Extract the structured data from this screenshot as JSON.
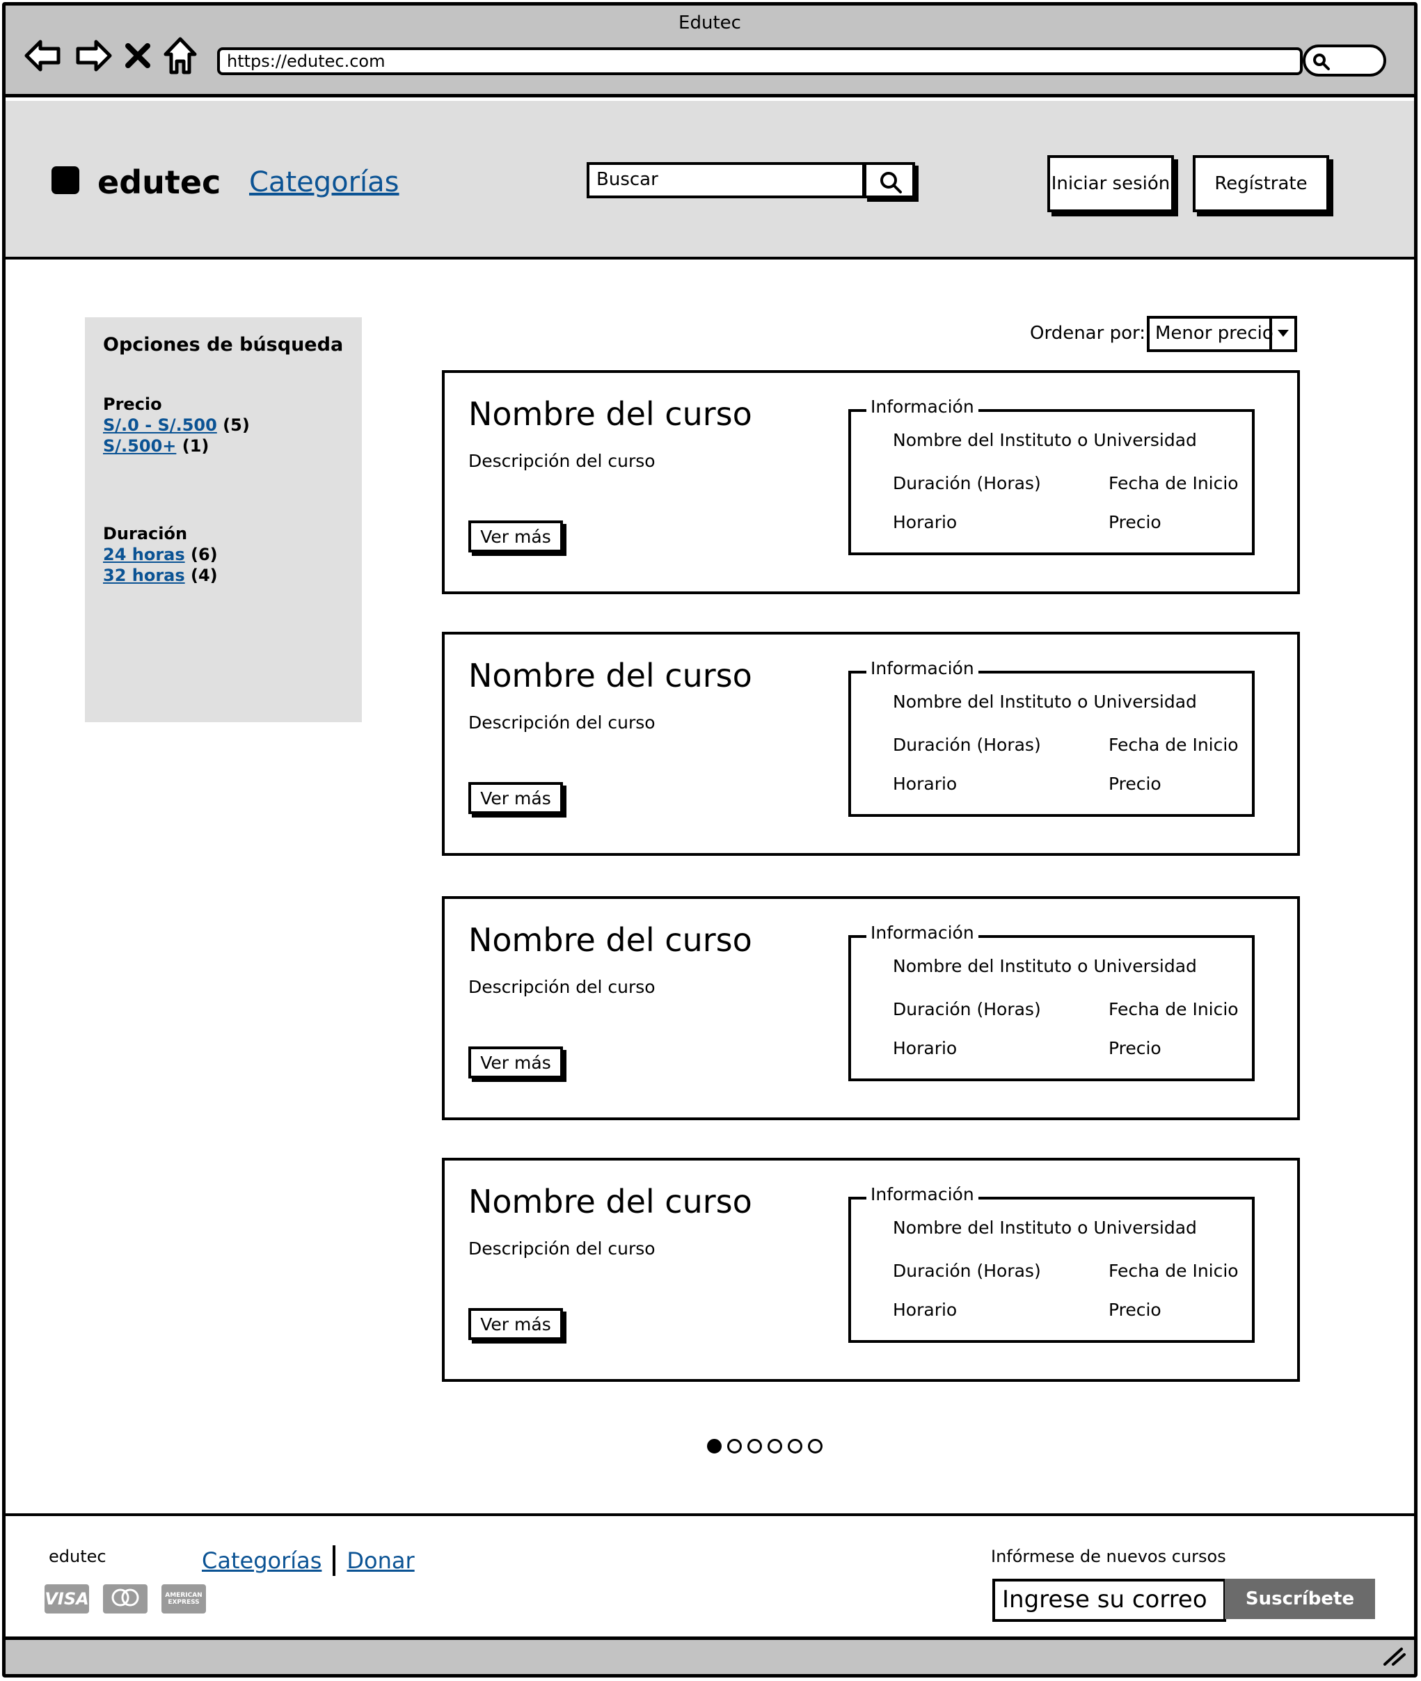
{
  "window": {
    "title": "Edutec"
  },
  "browser": {
    "url": "https://edutec.com",
    "icons": [
      "back-arrow-icon",
      "forward-arrow-icon",
      "close-x-icon",
      "home-icon",
      "search-icon"
    ]
  },
  "header": {
    "brand": "edutec",
    "categories_link": "Categorías",
    "search_placeholder": "Buscar",
    "login_label": "Iniciar sesión",
    "register_label": "Regístrate"
  },
  "sidebar": {
    "title": "Opciones de búsqueda",
    "groups": [
      {
        "label": "Precio",
        "options": [
          {
            "text": "S/.0 - S/.500",
            "count": "(5)"
          },
          {
            "text": "S/.500+",
            "count": "(1)"
          }
        ]
      },
      {
        "label": "Duración",
        "options": [
          {
            "text": "24 horas",
            "count": "(6)"
          },
          {
            "text": "32 horas",
            "count": "(4)"
          }
        ]
      }
    ]
  },
  "sort": {
    "label": "Ordenar por:",
    "selected": "Menor precio"
  },
  "courses": [
    {
      "title": "Nombre del curso",
      "description": "Descripción del curso",
      "button": "Ver más",
      "info": {
        "legend": "Información",
        "institution": "Nombre del Instituto o Universidad",
        "duration": "Duración (Horas)",
        "start_date": "Fecha de Inicio",
        "schedule": "Horario",
        "price": "Precio"
      }
    },
    {
      "title": "Nombre del curso",
      "description": "Descripción del curso",
      "button": "Ver más",
      "info": {
        "legend": "Información",
        "institution": "Nombre del Instituto o Universidad",
        "duration": "Duración (Horas)",
        "start_date": "Fecha de Inicio",
        "schedule": "Horario",
        "price": "Precio"
      }
    },
    {
      "title": "Nombre del curso",
      "description": "Descripción del curso",
      "button": "Ver más",
      "info": {
        "legend": "Información",
        "institution": "Nombre del Instituto o Universidad",
        "duration": "Duración (Horas)",
        "start_date": "Fecha de Inicio",
        "schedule": "Horario",
        "price": "Precio"
      }
    },
    {
      "title": "Nombre del curso",
      "description": "Descripción del curso",
      "button": "Ver más",
      "info": {
        "legend": "Información",
        "institution": "Nombre del Instituto o Universidad",
        "duration": "Duración (Horas)",
        "start_date": "Fecha de Inicio",
        "schedule": "Horario",
        "price": "Precio"
      }
    }
  ],
  "pagination": {
    "pages": 6,
    "active": 1
  },
  "footer": {
    "brand": "edutec",
    "links": [
      "Categorías",
      "Donar"
    ],
    "payment": {
      "visa": "VISA",
      "mastercard": "mastercard",
      "amex": "AMERICAN EXPRESS"
    },
    "newsletter_label": "Infórmese de nuevos cursos",
    "email_placeholder": "Ingrese su correo",
    "subscribe_label": "Suscríbete"
  },
  "colors": {
    "link": "#0b5394",
    "chrome": "#c3c3c3",
    "header_bg": "#dedede",
    "sidebar_bg": "#e0e0e0",
    "subscribe_bg": "#6b6b6b"
  }
}
